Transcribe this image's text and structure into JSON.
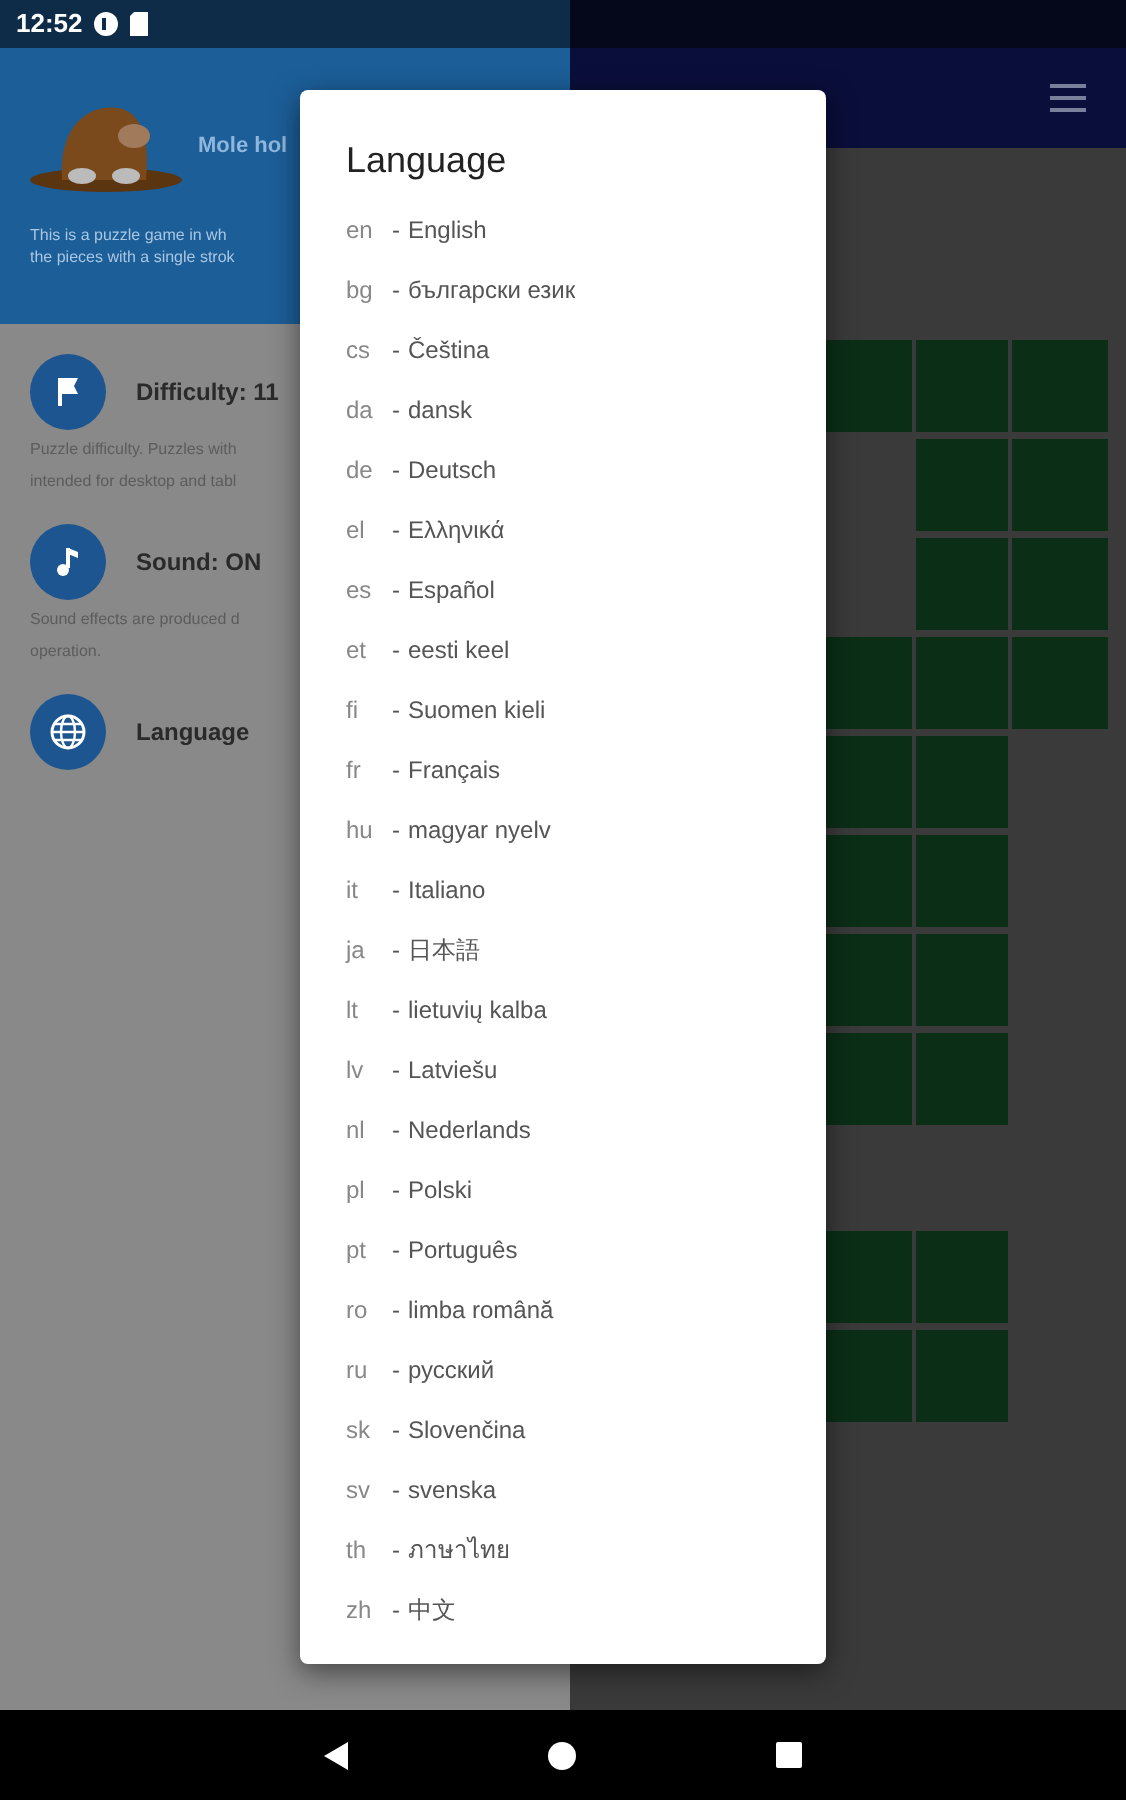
{
  "status_bar": {
    "time": "12:52"
  },
  "drawer": {
    "app_name": "Mole hol",
    "description": [
      "This is a puzzle game in wh",
      "the pieces with a single strok"
    ],
    "items": [
      {
        "kind": "difficulty",
        "label": "Difficulty: 11",
        "description": [
          "Puzzle difficulty. Puzzles with",
          "intended for desktop and tabl"
        ]
      },
      {
        "kind": "sound",
        "label": "Sound: ON",
        "description": [
          "Sound effects are produced d",
          "operation."
        ]
      },
      {
        "kind": "language",
        "label": "Language"
      }
    ]
  },
  "dialog": {
    "title": "Language",
    "options": [
      {
        "code": "en",
        "separator": "-",
        "name": "English"
      },
      {
        "code": "bg",
        "separator": "-",
        "name": "български език"
      },
      {
        "code": "cs",
        "separator": "-",
        "name": "Čeština"
      },
      {
        "code": "da",
        "separator": "-",
        "name": "dansk"
      },
      {
        "code": "de",
        "separator": "-",
        "name": "Deutsch"
      },
      {
        "code": "el",
        "separator": "-",
        "name": "Ελληνικά"
      },
      {
        "code": "es",
        "separator": "-",
        "name": "Español"
      },
      {
        "code": "et",
        "separator": "-",
        "name": "eesti keel"
      },
      {
        "code": "fi",
        "separator": "-",
        "name": "Suomen kieli"
      },
      {
        "code": "fr",
        "separator": "-",
        "name": "Français"
      },
      {
        "code": "hu",
        "separator": "-",
        "name": "magyar nyelv"
      },
      {
        "code": "it",
        "separator": "-",
        "name": "Italiano"
      },
      {
        "code": "ja",
        "separator": "-",
        "name": "日本語"
      },
      {
        "code": "lt",
        "separator": "-",
        "name": "lietuvių kalba"
      },
      {
        "code": "lv",
        "separator": "-",
        "name": "Latviešu"
      },
      {
        "code": "nl",
        "separator": "-",
        "name": "Nederlands"
      },
      {
        "code": "pl",
        "separator": "-",
        "name": "Polski"
      },
      {
        "code": "pt",
        "separator": "-",
        "name": "Português"
      },
      {
        "code": "ro",
        "separator": "-",
        "name": "limba română"
      },
      {
        "code": "ru",
        "separator": "-",
        "name": "русский"
      },
      {
        "code": "sk",
        "separator": "-",
        "name": "Slovenčina"
      },
      {
        "code": "sv",
        "separator": "-",
        "name": "svenska"
      },
      {
        "code": "th",
        "separator": "-",
        "name": "ภาษาไทย"
      },
      {
        "code": "zh",
        "separator": "-",
        "name": "中文"
      }
    ]
  }
}
